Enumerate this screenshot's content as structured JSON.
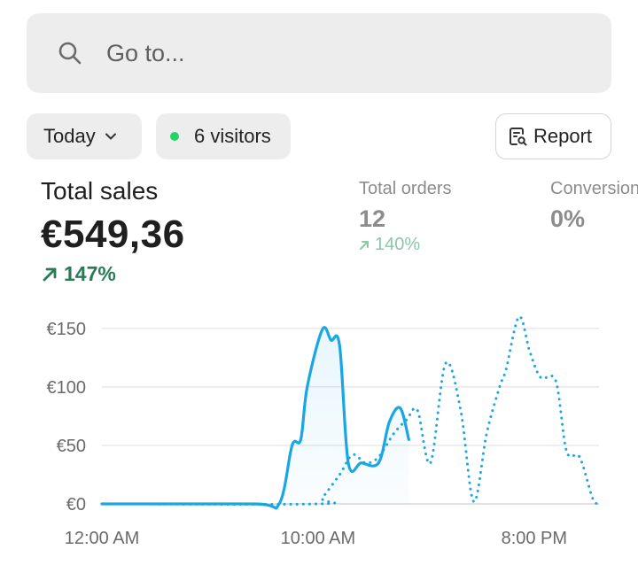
{
  "search": {
    "placeholder": "Go to..."
  },
  "filters": {
    "date_label": "Today",
    "visitors_label": "6 visitors",
    "report_label": "Report"
  },
  "metrics": {
    "total_sales": {
      "label": "Total sales",
      "value": "€549,36",
      "change": "147%"
    },
    "total_orders": {
      "label": "Total orders",
      "value": "12",
      "change": "140%"
    },
    "conversion": {
      "label": "Conversion",
      "value": "0%"
    }
  },
  "colors": {
    "accent_line": "#1aa6e2",
    "positive_trend": "#2a7a55",
    "positive_trend_muted": "#8cc7a8",
    "live_dot": "#22d36a"
  },
  "chart_data": {
    "type": "line",
    "y_tick_labels": [
      "€0",
      "€50",
      "€100",
      "€150"
    ],
    "y_ticks": [
      0,
      50,
      100,
      150
    ],
    "ylim": [
      0,
      165
    ],
    "x_tick_labels": [
      "12:00 AM",
      "10:00 AM",
      "8:00 PM"
    ],
    "x_tick_hours": [
      0,
      10,
      20
    ],
    "xlim": [
      0,
      23
    ],
    "grid": true,
    "series": [
      {
        "style": "solid",
        "color": "#1aa6e2",
        "x": [
          0,
          7,
          8.2,
          8.8,
          9.2,
          9.5,
          10.2,
          10.6,
          11,
          11.4,
          12,
          12.8,
          13.3,
          13.8,
          14.2
        ],
        "y": [
          0,
          0,
          0,
          50,
          55,
          100,
          149,
          140,
          135,
          35,
          35,
          35,
          70,
          82,
          55
        ]
      },
      {
        "style": "dotted",
        "color": "#1aa6e2",
        "x": [
          0,
          10,
          10.2,
          11,
          11.6,
          12.2,
          12.8,
          13.5,
          14.1,
          14.6,
          15.2,
          15.9,
          16.6,
          17.2,
          17.8,
          18.4,
          18.7,
          19.3,
          19.8,
          20.3,
          21,
          21.5,
          22.1,
          22.7,
          23
        ],
        "y": [
          0,
          0,
          5,
          25,
          42,
          35,
          40,
          60,
          72,
          80,
          35,
          120,
          80,
          2,
          60,
          100,
          115,
          160,
          130,
          108,
          105,
          45,
          40,
          5,
          0
        ]
      }
    ]
  }
}
